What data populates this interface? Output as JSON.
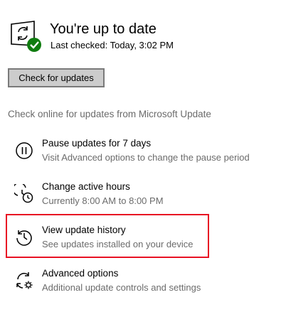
{
  "status": {
    "title": "You're up to date",
    "last_checked": "Last checked: Today, 3:02 PM"
  },
  "check_button_label": "Check for updates",
  "online_link": "Check online for updates from Microsoft Update",
  "options": [
    {
      "title": "Pause updates for 7 days",
      "description": "Visit Advanced options to change the pause period",
      "icon": "pause-icon"
    },
    {
      "title": "Change active hours",
      "description": "Currently 8:00 AM to 8:00 PM",
      "icon": "active-hours-icon"
    },
    {
      "title": "View update history",
      "description": "See updates installed on your device",
      "icon": "history-icon"
    },
    {
      "title": "Advanced options",
      "description": "Additional update controls and settings",
      "icon": "advanced-options-icon"
    }
  ],
  "colors": {
    "check_badge": "#107c10",
    "highlight_border": "#e81123",
    "secondary_text": "#6b6b6b",
    "button_bg": "#cccccc"
  }
}
